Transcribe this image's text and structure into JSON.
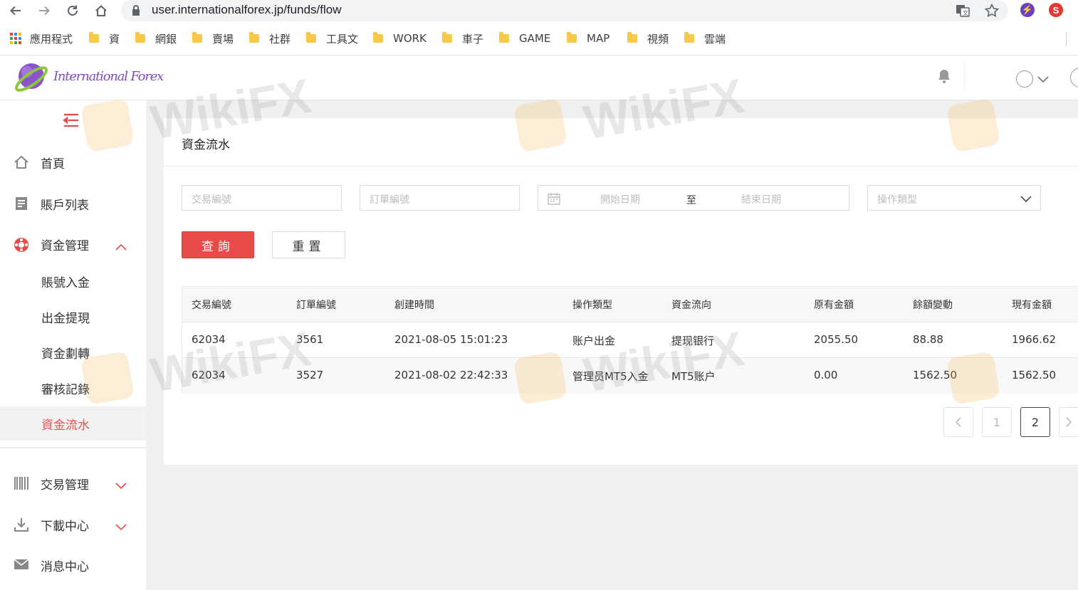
{
  "browser": {
    "url": "user.internationalforex.jp/funds/flow",
    "bookmarks": [
      "應用程式",
      "資",
      "網銀",
      "賣場",
      "社群",
      "工具文",
      "WORK",
      "車子",
      "GAME",
      "MAP",
      "視頻",
      "雲端"
    ]
  },
  "header": {
    "logo_text": "International Forex"
  },
  "sidebar": {
    "items": [
      {
        "label": "首頁",
        "icon": "home-icon"
      },
      {
        "label": "賬戶列表",
        "icon": "list-icon"
      },
      {
        "label": "資金管理",
        "icon": "funds-icon"
      },
      {
        "label": "交易管理",
        "icon": "barcode-icon"
      },
      {
        "label": "下載中心",
        "icon": "download-icon"
      },
      {
        "label": "消息中心",
        "icon": "mail-icon"
      }
    ],
    "subitems": [
      "賬號入金",
      "出金提現",
      "資金劃轉",
      "審核記錄",
      "資金流水"
    ],
    "active_subitem": "資金流水"
  },
  "page": {
    "title": "資金流水"
  },
  "filters": {
    "trade_no_placeholder": "交易編號",
    "order_no_placeholder": "訂單編號",
    "start_date_placeholder": "開始日期",
    "date_separator": "至",
    "end_date_placeholder": "結束日期",
    "op_type_placeholder": "操作類型",
    "query_label": "查詢",
    "reset_label": "重置"
  },
  "table": {
    "columns": [
      "交易編號",
      "訂單編號",
      "創建時間",
      "操作類型",
      "資金流向",
      "原有金額",
      "餘額變動",
      "現有金額"
    ],
    "rows": [
      [
        "62034",
        "3561",
        "2021-08-05 15:01:23",
        "账户出金",
        "提现银行",
        "2055.50",
        "88.88",
        "1966.62"
      ],
      [
        "62034",
        "3527",
        "2021-08-02 22:42:33",
        "管理员MT5入金",
        "MT5账户",
        "0.00",
        "1562.50",
        "1562.50"
      ]
    ]
  },
  "pagination": {
    "pages": [
      "1",
      "2"
    ],
    "current": "2"
  },
  "watermark": "WikiFX",
  "colors": {
    "accent_red": "#e94b4b",
    "active_text": "#e8504f",
    "logo_purple": "#7e4fb8"
  }
}
